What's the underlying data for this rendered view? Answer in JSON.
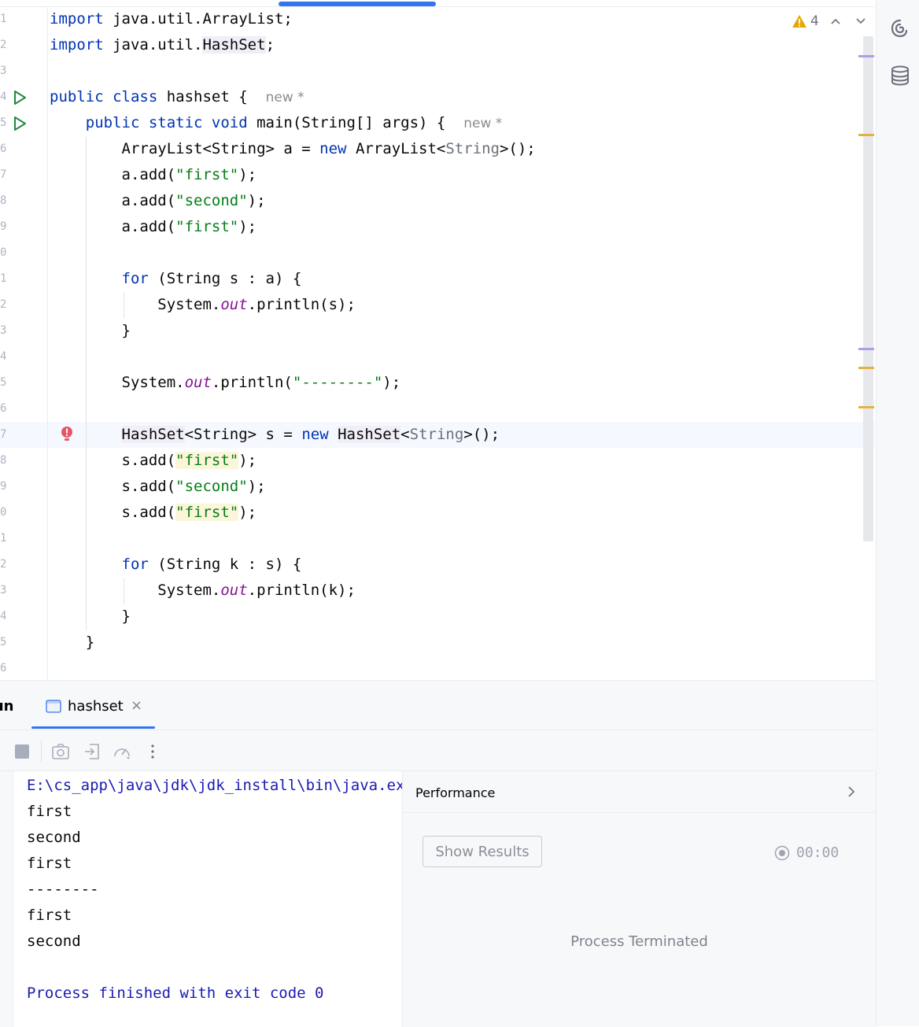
{
  "editor": {
    "line_numbers": [
      "1",
      "2",
      "3",
      "4",
      "5",
      "6",
      "7",
      "8",
      "9",
      "0",
      "1",
      "2",
      "3",
      "4",
      "5",
      "6",
      "7",
      "8",
      "9",
      "0",
      "1",
      "2",
      "3",
      "4",
      "5",
      "6"
    ],
    "lines": [
      [
        {
          "t": "import",
          "c": "kw"
        },
        {
          "t": " java.util.ArrayList;"
        }
      ],
      [
        {
          "t": "import",
          "c": "kw"
        },
        {
          "t": " java.util."
        },
        {
          "t": "HashSet",
          "c": "hl"
        },
        {
          "t": ";"
        }
      ],
      [],
      [
        {
          "t": "public class",
          "c": "kw"
        },
        {
          "t": " hashset {  "
        },
        {
          "t": "new *",
          "c": "hint"
        }
      ],
      [
        {
          "t": "    "
        },
        {
          "t": "public static void",
          "c": "kw"
        },
        {
          "t": " main(String[] args) {  "
        },
        {
          "t": "new *",
          "c": "hint"
        }
      ],
      [
        {
          "t": "        ArrayList<String> a = "
        },
        {
          "t": "new",
          "c": "kw"
        },
        {
          "t": " ArrayList<"
        },
        {
          "t": "String",
          "c": "gen"
        },
        {
          "t": ">();"
        }
      ],
      [
        {
          "t": "        a.add("
        },
        {
          "t": "\"first\"",
          "c": "str"
        },
        {
          "t": ");"
        }
      ],
      [
        {
          "t": "        a.add("
        },
        {
          "t": "\"second\"",
          "c": "str"
        },
        {
          "t": ");"
        }
      ],
      [
        {
          "t": "        a.add("
        },
        {
          "t": "\"first\"",
          "c": "str"
        },
        {
          "t": ");"
        }
      ],
      [],
      [
        {
          "t": "        "
        },
        {
          "t": "for",
          "c": "kw"
        },
        {
          "t": " (String s : a) {"
        }
      ],
      [
        {
          "t": "            System."
        },
        {
          "t": "out",
          "c": "fld"
        },
        {
          "t": ".println(s);"
        }
      ],
      [
        {
          "t": "        }"
        }
      ],
      [],
      [
        {
          "t": "        System."
        },
        {
          "t": "out",
          "c": "fld"
        },
        {
          "t": ".println("
        },
        {
          "t": "\"--------\"",
          "c": "str"
        },
        {
          "t": ");"
        }
      ],
      [],
      [
        {
          "t": "        "
        },
        {
          "t": "HashSet",
          "c": "hl"
        },
        {
          "t": "<String> s = "
        },
        {
          "t": "new",
          "c": "kw"
        },
        {
          "t": " "
        },
        {
          "t": "HashSet",
          "c": "hl"
        },
        {
          "t": "<"
        },
        {
          "t": "String",
          "c": "gen"
        },
        {
          "t": ">();"
        }
      ],
      [
        {
          "t": "        s.add("
        },
        {
          "t": "\"first\"",
          "c": "str warnhl"
        },
        {
          "t": ");"
        }
      ],
      [
        {
          "t": "        s.add("
        },
        {
          "t": "\"second\"",
          "c": "str"
        },
        {
          "t": ");"
        }
      ],
      [
        {
          "t": "        s.add("
        },
        {
          "t": "\"first\"",
          "c": "str warnhl"
        },
        {
          "t": ");"
        }
      ],
      [],
      [
        {
          "t": "        "
        },
        {
          "t": "for",
          "c": "kw"
        },
        {
          "t": " (String k : s) {"
        }
      ],
      [
        {
          "t": "            System."
        },
        {
          "t": "out",
          "c": "fld"
        },
        {
          "t": ".println(k);"
        }
      ],
      [
        {
          "t": "        }"
        }
      ],
      [
        {
          "t": "    }"
        }
      ],
      []
    ],
    "warning_count": "4",
    "icons": {
      "warning": "warning-triangle-icon",
      "up": "chevron-up-icon",
      "down": "chevron-down-icon",
      "run": "run-gutter-icon",
      "error": "error-bulb-icon"
    },
    "colors": {
      "keyword": "#0033b3",
      "string": "#067d17",
      "field": "#871094",
      "accent": "#3574f0",
      "warning": "#e6a700",
      "marker_purple": "#b09ce8",
      "marker_yellow": "#e3b341"
    }
  },
  "run_panel": {
    "label": "Run",
    "tab_label": "hashset",
    "tab_close": "×",
    "toolbar": [
      "stop-icon",
      "camera-icon",
      "restore-layout-icon",
      "profiler-icon",
      "more-vertical-icon"
    ],
    "console_lines": [
      {
        "t": "E:\\cs_app\\java\\jdk\\jdk_install\\bin\\java.exe",
        "c": "cblue"
      },
      {
        "t": "first"
      },
      {
        "t": "second"
      },
      {
        "t": "first"
      },
      {
        "t": "--------"
      },
      {
        "t": "first"
      },
      {
        "t": "second"
      },
      {
        "t": ""
      },
      {
        "t": "Process finished with exit code 0",
        "c": "cblue"
      }
    ],
    "performance": {
      "title": "Performance",
      "show_results": "Show Results",
      "timer": "00:00",
      "status": "Process Terminated"
    }
  },
  "right_strip": [
    "ai-assistant-icon",
    "database-icon"
  ]
}
